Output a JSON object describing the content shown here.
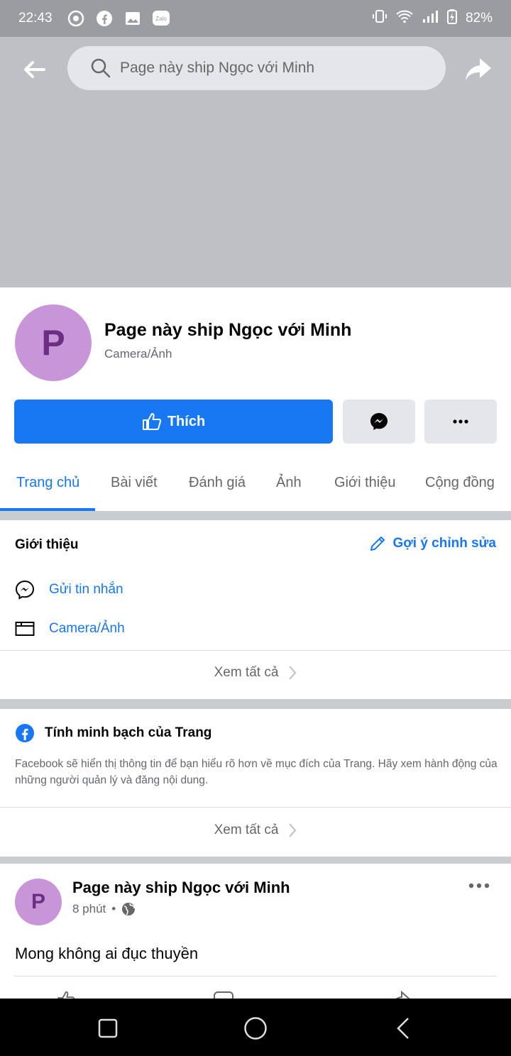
{
  "status_bar": {
    "time": "22:43",
    "battery": "82%",
    "left_icons": [
      "chrome-icon",
      "facebook-icon",
      "gallery-icon",
      "zalo-icon"
    ],
    "zalo_label": "Zalo"
  },
  "header": {
    "search_placeholder": "Page này ship Ngọc với Minh"
  },
  "page": {
    "name": "Page này ship Ngọc với Minh",
    "category": "Camera/Ảnh",
    "avatar_letter": "P"
  },
  "actions": {
    "like_label": "Thích"
  },
  "tabs": [
    {
      "label": "Trang chủ",
      "active": true
    },
    {
      "label": "Bài viết",
      "active": false
    },
    {
      "label": "Đánh giá",
      "active": false
    },
    {
      "label": "Ảnh",
      "active": false
    },
    {
      "label": "Giới thiệu",
      "active": false
    },
    {
      "label": "Cộng đồng",
      "active": false
    }
  ],
  "about": {
    "title": "Giới thiệu",
    "suggest_label": "Gợi ý chỉnh sửa",
    "rows": [
      {
        "icon": "messenger-icon",
        "label": "Gửi tin nhắn"
      },
      {
        "icon": "category-icon",
        "label": "Camera/Ảnh"
      }
    ],
    "see_all": "Xem tất cả"
  },
  "transparency": {
    "title": "Tính minh bạch của Trang",
    "text": "Facebook sẽ hiển thị thông tin để bạn hiểu rõ hơn về mục đích của Trang. Hãy xem hành động của những người quản lý và đăng nội dung.",
    "see_all": "Xem tất cả"
  },
  "post": {
    "author": "Page này ship Ngọc với Minh",
    "time": "8 phút",
    "separator": "•",
    "text": "Mong không ai đục thuyền",
    "avatar_letter": "P"
  },
  "colors": {
    "accent": "#1877f2",
    "cover": "#bec0c5",
    "avatar": "#c896d8",
    "status_bar": "#9a9ca1"
  }
}
